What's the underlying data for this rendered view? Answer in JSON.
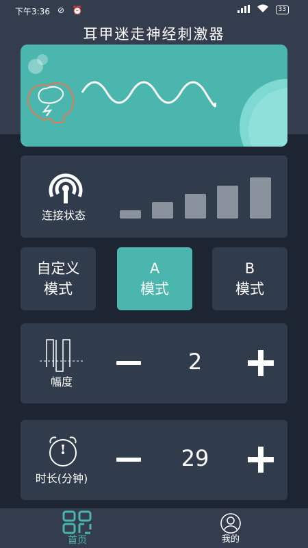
{
  "status_bar": {
    "time": "下午3:36",
    "battery": "33"
  },
  "app": {
    "title": "耳甲迷走神经刺激器"
  },
  "colors": {
    "accent": "#4ab6ae",
    "background": "#1d2532",
    "panel": "#303b4b",
    "header": "#333d4d"
  },
  "connection": {
    "label": "连接状态",
    "icon": "wireless-signal-icon",
    "signal_bars": [
      1,
      2,
      3,
      4,
      5
    ]
  },
  "modes": [
    {
      "line1": "自定义",
      "line2": "模式",
      "active": false
    },
    {
      "line1": "A",
      "line2": "模式",
      "active": true
    },
    {
      "line1": "B",
      "line2": "模式",
      "active": false
    }
  ],
  "amplitude": {
    "label": "幅度",
    "value": "2",
    "icon": "waveform-icon"
  },
  "duration": {
    "label": "时长(分钟)",
    "value": "29",
    "icon": "timer-icon"
  },
  "tabs": [
    {
      "label": "首页",
      "icon": "grid-icon",
      "active": true
    },
    {
      "label": "我的",
      "icon": "user-icon",
      "active": false
    }
  ]
}
